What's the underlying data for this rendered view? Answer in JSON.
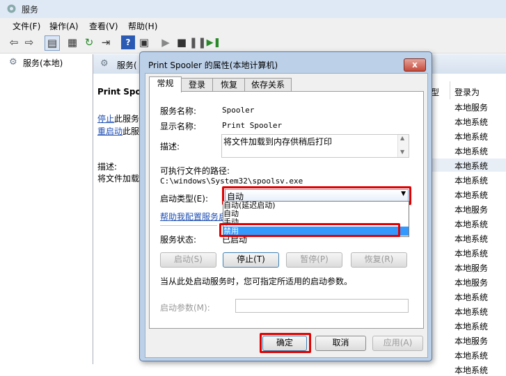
{
  "main": {
    "title": "服务",
    "menu": [
      "文件(F)",
      "操作(A)",
      "查看(V)",
      "帮助(H)"
    ],
    "tree_item": "服务(本地)",
    "pane_title": "服务(",
    "service_name": "Print Spoo",
    "stop_link": "停止",
    "stop_rest": "此服务",
    "restart_link": "重启动",
    "restart_rest": "此服",
    "desc_label": "描述:",
    "desc_text": "将文件加载",
    "col_type": "型",
    "col_logon": "登录为",
    "logon_values": [
      "本地服务",
      "本地系统",
      "本地系统",
      "本地系统",
      "本地系统",
      "本地系统",
      "本地系统",
      "本地服务",
      "本地系统",
      "本地系统",
      "本地系统",
      "本地服务",
      "本地服务",
      "本地系统",
      "本地系统",
      "本地系统",
      "本地服务",
      "本地系统",
      "本地系统"
    ]
  },
  "dialog": {
    "title": "Print Spooler 的属性(本地计算机)",
    "close": "x",
    "tabs": [
      "常规",
      "登录",
      "恢复",
      "依存关系"
    ],
    "service_name_label": "服务名称:",
    "service_name_value": "Spooler",
    "display_name_label": "显示名称:",
    "display_name_value": "Print Spooler",
    "description_label": "描述:",
    "description_value": "将文件加载到内存供稍后打印",
    "exe_path_label": "可执行文件的路径:",
    "exe_path_value": "C:\\windows\\System32\\spoolsv.exe",
    "startup_type_label": "启动类型(E):",
    "startup_type_value": "自动",
    "startup_options": [
      "自动(延迟启动)",
      "自动",
      "手动",
      "禁用"
    ],
    "help_link": "帮助我配置服务启",
    "service_status_label": "服务状态:",
    "service_status_value": "已启动",
    "start_btn": "启动(S)",
    "stop_btn": "停止(T)",
    "pause_btn": "暂停(P)",
    "resume_btn": "恢复(R)",
    "hint": "当从此处启动服务时，您可指定所适用的启动参数。",
    "start_params_label": "启动参数(M):",
    "ok_btn": "确定",
    "cancel_btn": "取消",
    "apply_btn": "应用(A)"
  },
  "colors": {
    "highlight": "#3399ff",
    "annotation": "#e00000"
  }
}
